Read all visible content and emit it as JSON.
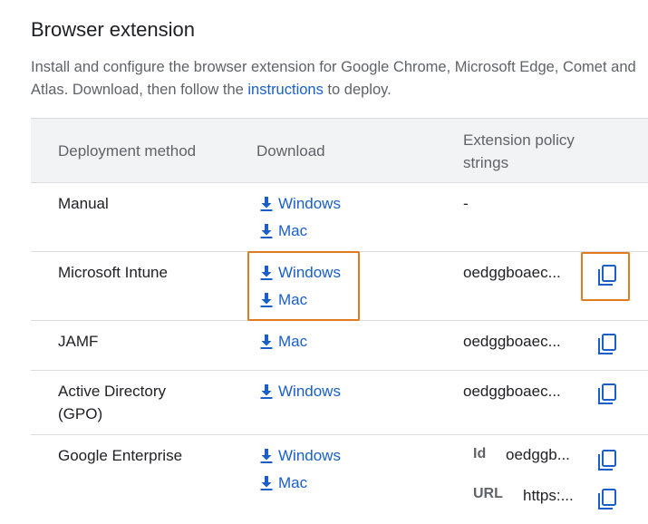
{
  "section": {
    "title": "Browser extension",
    "desc_prefix": "Install and configure the browser extension for Google Chrome, Microsoft Edge, Comet and Atlas. Download, then follow the ",
    "desc_link": "instructions",
    "desc_suffix": " to deploy."
  },
  "table": {
    "headers": {
      "method": "Deployment method",
      "download": "Download",
      "policy_line1": "Extension policy",
      "policy_line2": "strings"
    },
    "rows": [
      {
        "method": "Manual",
        "downloads": [
          "Windows",
          "Mac"
        ],
        "policy": "-"
      },
      {
        "method": "Microsoft Intune",
        "downloads": [
          "Windows",
          "Mac"
        ],
        "policy": "oedggboaec..."
      },
      {
        "method": "JAMF",
        "downloads": [
          "Mac"
        ],
        "policy": "oedggboaec..."
      },
      {
        "method_line1": "Active Directory",
        "method_line2": "(GPO)",
        "downloads": [
          "Windows"
        ],
        "policy": "oedggboaec..."
      },
      {
        "method": "Google Enterprise",
        "downloads": [
          "Windows",
          "Mac"
        ],
        "policy_id_label": "Id",
        "policy_id_value": "oedggb...",
        "policy_url_label": "URL",
        "policy_url_value": "https:..."
      }
    ]
  },
  "colors": {
    "link": "#1a5fc7",
    "highlight": "#e07b1f",
    "header_bg": "#f1f3f4"
  },
  "icons": {
    "download": "download-arrow-icon",
    "copy": "copy-icon"
  }
}
